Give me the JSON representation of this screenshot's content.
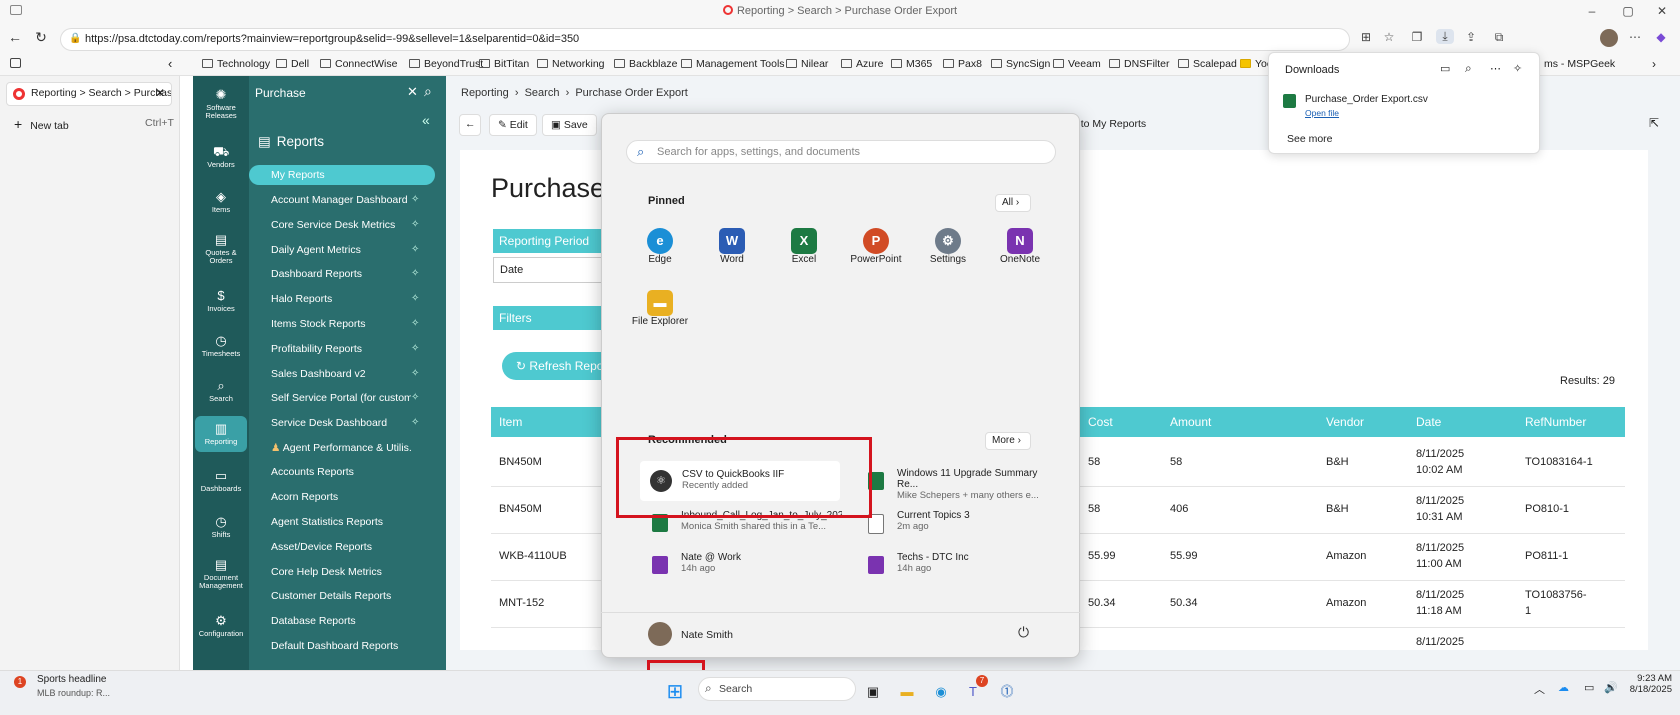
{
  "browser": {
    "window_title": "Reporting > Search > Purchase Order Export",
    "url": "https://psa.dtctoday.com/reports?mainview=reportgroup&selid=-99&sellevel=1&selparentid=0&id=350",
    "tab_label": "Reporting > Search > Purchase C",
    "new_tab": "New tab",
    "new_tab_shortcut": "Ctrl+T",
    "bookmarks": [
      "Technology",
      "Dell",
      "ConnectWise",
      "BeyondTrust",
      "BitTitan",
      "Networking",
      "Backblaze",
      "Management Tools",
      "Nilear",
      "Azure",
      "M365",
      "Pax8",
      "SyncSign",
      "Veeam",
      "DNSFilter",
      "Scalepad",
      "Yoo",
      "ms - MSPGeek"
    ]
  },
  "downloads": {
    "title": "Downloads",
    "file": "Purchase_Order Export.csv",
    "open": "Open file",
    "see_more": "See more"
  },
  "sidebar": {
    "items": [
      {
        "label": "Software Releases",
        "icon": "cog-icon"
      },
      {
        "label": "Vendors",
        "icon": "truck-icon"
      },
      {
        "label": "Items",
        "icon": "box-icon"
      },
      {
        "label": "Quotes & Orders",
        "icon": "doc-icon"
      },
      {
        "label": "Invoices",
        "icon": "money-icon"
      },
      {
        "label": "Timesheets",
        "icon": "clock-icon"
      },
      {
        "label": "Search",
        "icon": "search-icon"
      },
      {
        "label": "Reporting",
        "icon": "report-icon"
      },
      {
        "label": "Dashboards",
        "icon": "monitor-icon"
      },
      {
        "label": "Shifts",
        "icon": "clock-icon"
      },
      {
        "label": "Document Management",
        "icon": "doc-icon"
      },
      {
        "label": "Configuration",
        "icon": "gear-icon"
      }
    ]
  },
  "panel": {
    "title": "Purchase",
    "reports_title": "Reports",
    "items": [
      "My Reports",
      "Account Manager Dashboard ...",
      "Core Service Desk Metrics",
      "Daily Agent Metrics",
      "Dashboard Reports",
      "Halo Reports",
      "Items Stock Reports",
      "Profitability Reports",
      "Sales Dashboard v2",
      "Self Service Portal (for custom...",
      "Service Desk Dashboard",
      "Agent Performance & Utilis...",
      "Accounts Reports",
      "Acorn Reports",
      "Agent Statistics Reports",
      "Asset/Device Reports",
      "Core Help Desk Metrics",
      "Customer Details Reports",
      "Database Reports",
      "Default Dashboard Reports"
    ]
  },
  "main": {
    "breadcrumb": [
      "Reporting",
      "Search",
      "Purchase Order Export"
    ],
    "edit": "Edit",
    "save": "Save",
    "add_to_my_reports": "d to My Reports",
    "title": "Purchase",
    "reporting_period": "Reporting Period",
    "date": "Date",
    "filters": "Filters",
    "refresh": "Refresh Repo",
    "results": "Results: 29",
    "columns": [
      "Item",
      "Cost",
      "Amount",
      "Vendor",
      "Date",
      "RefNumber"
    ],
    "rows": [
      [
        "BN450M",
        "58",
        "58",
        "B&H",
        "8/11/2025",
        "10:02 AM",
        "TO1083164-1"
      ],
      [
        "BN450M",
        "58",
        "406",
        "B&H",
        "8/11/2025",
        "10:31 AM",
        "PO810-1"
      ],
      [
        "WKB-4110UB",
        "55.99",
        "55.99",
        "Amazon",
        "8/11/2025",
        "11:00 AM",
        "PO811-1"
      ],
      [
        "MNT-152",
        "50.34",
        "50.34",
        "Amazon",
        "8/11/2025",
        "11:18 AM",
        "TO1083756-",
        "1"
      ],
      [
        "",
        "",
        "",
        "",
        "8/11/2025",
        "",
        ""
      ]
    ]
  },
  "start_menu": {
    "search_placeholder": "Search for apps, settings, and documents",
    "pinned": "Pinned",
    "all": "All",
    "apps": [
      {
        "name": "Edge",
        "color": "#1b8fd6",
        "glyph": "e"
      },
      {
        "name": "Word",
        "color": "#2b5cb4",
        "glyph": "W"
      },
      {
        "name": "Excel",
        "color": "#1d7a43",
        "glyph": "X"
      },
      {
        "name": "PowerPoint",
        "color": "#d14b25",
        "glyph": "P"
      },
      {
        "name": "Settings",
        "color": "#6e7b8a",
        "glyph": "⚙"
      },
      {
        "name": "OneNote",
        "color": "#7a33b0",
        "glyph": "N"
      },
      {
        "name": "File Explorer",
        "color": "#e9b022",
        "glyph": "▬"
      }
    ],
    "recommended": "Recommended",
    "more": "More",
    "recs": [
      {
        "title": "CSV to QuickBooks IIF",
        "sub": "Recently added"
      },
      {
        "title": "Windows 11 Upgrade Summary Re...",
        "sub": "Mike Schepers + many others e..."
      },
      {
        "title": "Inbound_Call_Log_Jan_to_July_2025...",
        "sub": "Monica Smith shared this in a Te..."
      },
      {
        "title": "Current Topics 3",
        "sub": "2m ago"
      },
      {
        "title": "Nate @ Work",
        "sub": "14h ago"
      },
      {
        "title": "Techs - DTC Inc",
        "sub": "14h ago"
      }
    ],
    "user": "Nate Smith"
  },
  "taskbar": {
    "news_title": "Sports headline",
    "news_sub": "MLB roundup: R...",
    "search": "Search",
    "time": "9:23 AM",
    "date": "8/18/2025",
    "teams_badge": "7",
    "news_badge": "1"
  }
}
